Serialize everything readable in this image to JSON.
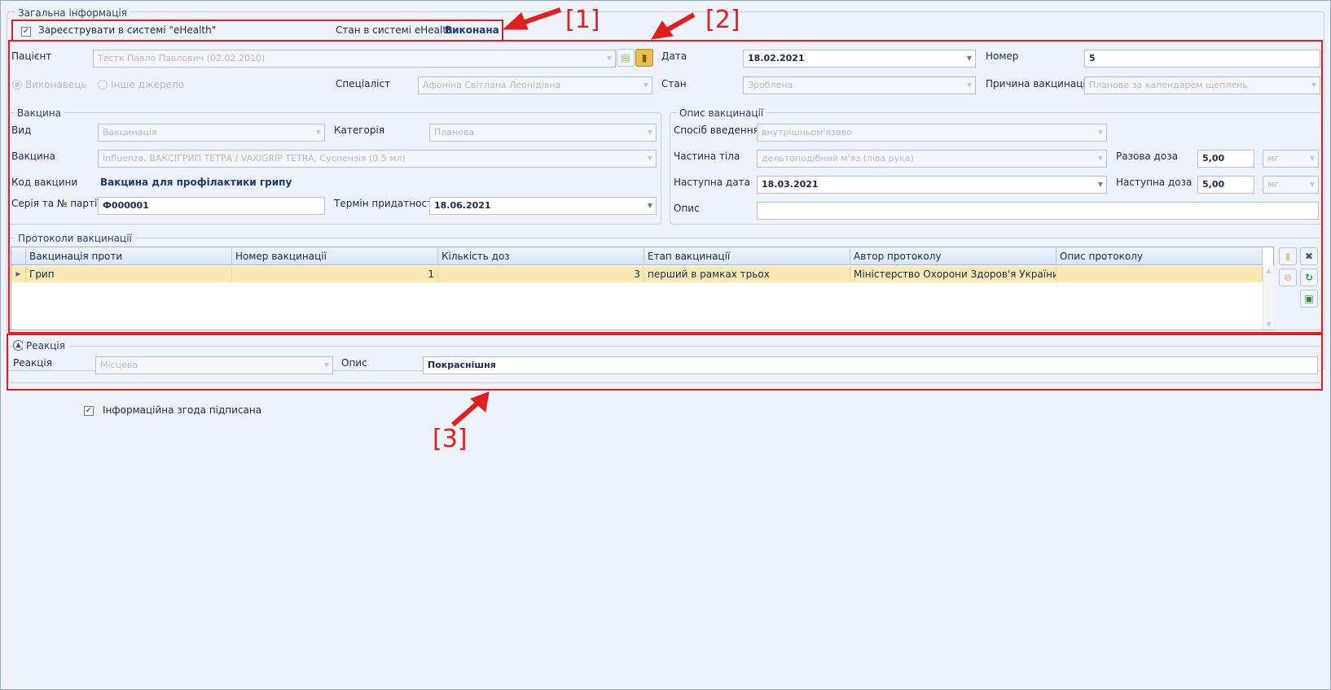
{
  "general": {
    "legend": "Загальна інформація",
    "register_label": "Зареєструвати в системі \"eHealth\"",
    "register_checked": true,
    "status_label": "Стан в системі eHealth",
    "status_value": "Виконана"
  },
  "main": {
    "patient_label": "Пацієнт",
    "patient_value": "Тестк Павло Павлович (02.02.2010)",
    "date_label": "Дата",
    "date_value": "18.02.2021",
    "number_label": "Номер",
    "number_value": "5",
    "performer_label": "Виконавець",
    "other_source_label": "Інше джерело",
    "specialist_label": "Спеціаліст",
    "specialist_value": "Афоніна Світлана Леонідівна",
    "state_label": "Стан",
    "state_value": "Зроблена",
    "reason_label": "Причина вакцинації",
    "reason_value": "Планове за календарем щеплень"
  },
  "vaccine": {
    "legend": "Вакцина",
    "type_label": "Вид",
    "type_value": "Вакцинація",
    "category_label": "Категорія",
    "category_value": "Планова",
    "vaccine_label": "Вакцина",
    "vaccine_value": "Influenza, ВАКСІГРИП ТЕТРА / VAXIGRIP TETRA, Суспензія (0.5 мл)",
    "code_label": "Код вакцини",
    "code_value": "Вакцина для профілактики грипу",
    "batch_label": "Серія та № партії",
    "batch_value": "Ф000001",
    "expiry_label": "Термін придатності",
    "expiry_value": "18.06.2021"
  },
  "description": {
    "legend": "Опис вакцинації",
    "route_label": "Спосіб введення",
    "route_value": "внутрішньом'язово",
    "body_part_label": "Частина тіла",
    "body_part_value": "дельтоподібний м'яз (ліва рука)",
    "single_dose_label": "Разова доза",
    "single_dose_value": "5,00",
    "single_dose_unit": "мг",
    "next_date_label": "Наступна дата",
    "next_date_value": "18.03.2021",
    "next_dose_label": "Наступна доза",
    "next_dose_value": "5,00",
    "next_dose_unit": "мг",
    "desc_label": "Опис",
    "desc_value": ""
  },
  "protocols": {
    "legend": "Протоколи вакцинації",
    "columns": [
      "Вакцинація проти",
      "Номер вакцинації",
      "Кількість доз",
      "Етап вакцинації",
      "Автор протоколу",
      "Опис протоколу"
    ],
    "rows": [
      [
        "Грип",
        "1",
        "3",
        "перший в рамках трьох",
        "Міністерство Охорони Здоров'я України",
        ""
      ]
    ]
  },
  "reaction": {
    "legend": "Реакція",
    "reaction_label": "Реакція",
    "reaction_value": "Місцева",
    "desc_label": "Опис",
    "desc_value": "Покраснішня"
  },
  "consent": {
    "label": "Інформаційна згода підписана",
    "checked": true
  },
  "callouts": [
    "[1]",
    "[2]",
    "[3]"
  ],
  "colors": {
    "annotation": "#e02020",
    "selected_row": "#fbe9b4",
    "background": "#eef2fa"
  }
}
